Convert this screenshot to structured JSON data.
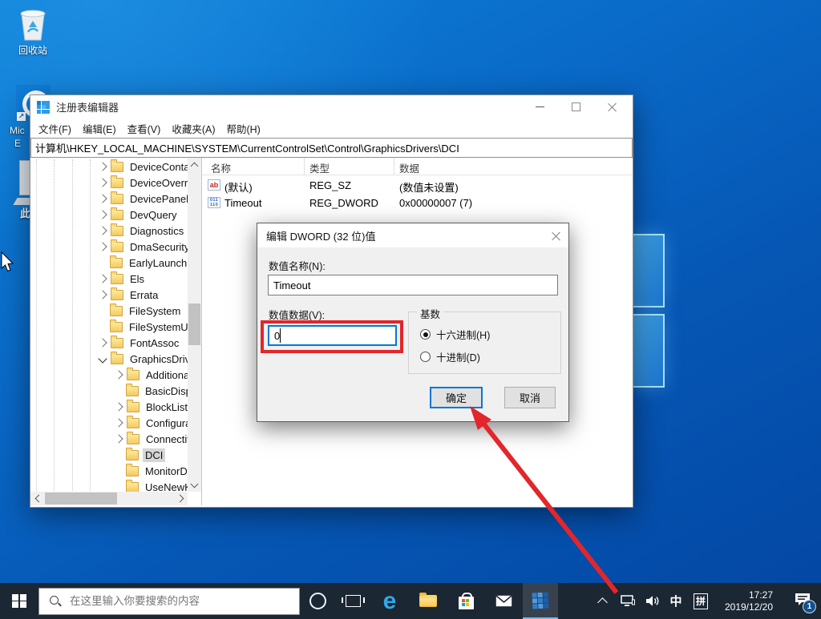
{
  "colors": {
    "accent": "#0078d7",
    "annotation_red": "#e2262b",
    "taskbar_bg": "#1b2733",
    "selection_gray": "#d6d6d6"
  },
  "desktop": {
    "recycle_label": "回收站",
    "edge_label_line1": "Mic",
    "edge_label_line2": "E",
    "thispc_label": "此"
  },
  "regedit": {
    "title": "注册表编辑器",
    "menus": [
      "文件(F)",
      "编辑(E)",
      "查看(V)",
      "收藏夹(A)",
      "帮助(H)"
    ],
    "address": "计算机\\HKEY_LOCAL_MACHINE\\SYSTEM\\CurrentControlSet\\Control\\GraphicsDrivers\\DCI",
    "columns": [
      "名称",
      "类型",
      "数据"
    ],
    "icon_glyphs": {
      "sz": "ab",
      "dword_top": "011",
      "dword_bottom": "110"
    },
    "tree": [
      {
        "label": "DeviceContai",
        "level": 0,
        "chevron": "right"
      },
      {
        "label": "DeviceOverri",
        "level": 0,
        "chevron": "right"
      },
      {
        "label": "DevicePanels",
        "level": 0,
        "chevron": "right"
      },
      {
        "label": "DevQuery",
        "level": 0,
        "chevron": "right"
      },
      {
        "label": "Diagnostics",
        "level": 0,
        "chevron": "right"
      },
      {
        "label": "DmaSecurity",
        "level": 0,
        "chevron": "right"
      },
      {
        "label": "EarlyLaunch",
        "level": 0,
        "chevron": "none"
      },
      {
        "label": "Els",
        "level": 0,
        "chevron": "right"
      },
      {
        "label": "Errata",
        "level": 0,
        "chevron": "right"
      },
      {
        "label": "FileSystem",
        "level": 0,
        "chevron": "none"
      },
      {
        "label": "FileSystemUti",
        "level": 0,
        "chevron": "none"
      },
      {
        "label": "FontAssoc",
        "level": 0,
        "chevron": "right"
      },
      {
        "label": "GraphicsDriv",
        "level": 0,
        "chevron": "down"
      },
      {
        "label": "Additional",
        "level": 1,
        "chevron": "right"
      },
      {
        "label": "BasicDispl",
        "level": 1,
        "chevron": "none"
      },
      {
        "label": "BlockList",
        "level": 1,
        "chevron": "right"
      },
      {
        "label": "Configurat",
        "level": 1,
        "chevron": "right"
      },
      {
        "label": "Connectivi",
        "level": 1,
        "chevron": "right"
      },
      {
        "label": "DCI",
        "level": 1,
        "chevron": "none",
        "selected": true
      },
      {
        "label": "MonitorDa",
        "level": 1,
        "chevron": "none"
      },
      {
        "label": "UseNewKe",
        "level": 1,
        "chevron": "none"
      }
    ],
    "rows": [
      {
        "icon": "sz",
        "name": "(默认)",
        "type": "REG_SZ",
        "data": "(数值未设置)"
      },
      {
        "icon": "dword",
        "name": "Timeout",
        "type": "REG_DWORD",
        "data": "0x00000007 (7)"
      }
    ]
  },
  "dialog": {
    "title": "编辑 DWORD (32 位)值",
    "name_label": "数值名称(N):",
    "name_value": "Timeout",
    "data_label": "数值数据(V):",
    "data_value": "0",
    "base_label": "基数",
    "hex_label": "十六进制(H)",
    "dec_label": "十进制(D)",
    "ok_label": "确定",
    "cancel_label": "取消"
  },
  "taskbar": {
    "search_placeholder": "在这里输入你要搜索的内容",
    "tray": {
      "ime_lang": "中",
      "ime_mode": "拼",
      "time": "17:27",
      "date": "2019/12/20",
      "notif_count": "1"
    }
  }
}
